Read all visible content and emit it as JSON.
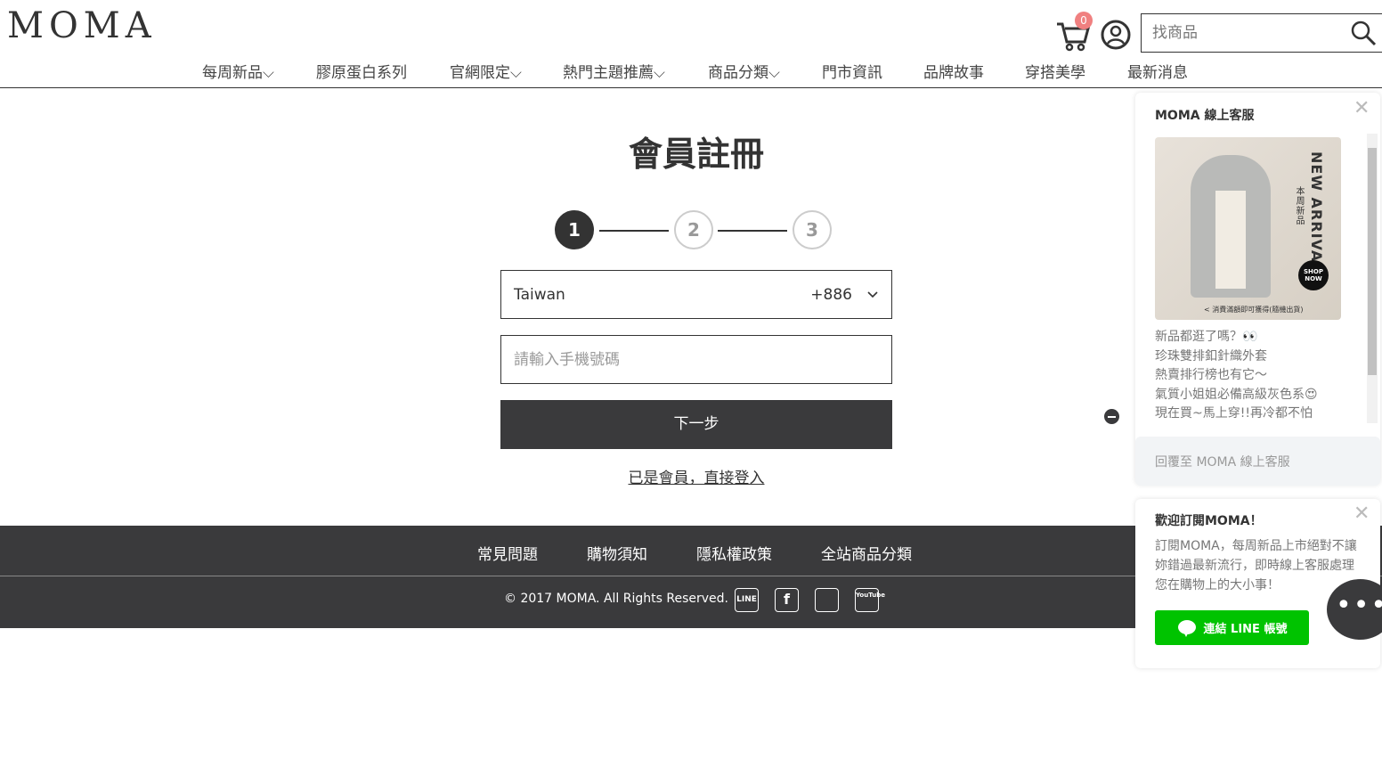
{
  "header": {
    "logo": "MOMA",
    "cart_count": "0",
    "search_placeholder": "找商品"
  },
  "nav": [
    "每周新品⌵",
    "膠原蛋白系列",
    "官網限定⌵",
    "熱門主題推薦⌵",
    "商品分類⌵",
    "門市資訊",
    "品牌故事",
    "穿搭美學",
    "最新消息"
  ],
  "main": {
    "title": "會員註冊",
    "steps": [
      "1",
      "2",
      "3"
    ],
    "current_step": 1,
    "country": "Taiwan",
    "country_code": "+886",
    "phone_placeholder": "請輸入手機號碼",
    "next_label": "下一步",
    "login_link": "已是會員，直接登入"
  },
  "footer": {
    "links": [
      "常見問題",
      "購物須知",
      "隱私權政策",
      "全站商品分類"
    ],
    "copyright": "© 2017 MOMA. All Rights Reserved.",
    "social": [
      "LINE",
      "f",
      "IG",
      "YouTube"
    ]
  },
  "chat": {
    "title": "MOMA 線上客服",
    "promo_title": "NEW ARRIVAL",
    "promo_sub": "本周新品",
    "promo_btn": "SHOP NOW",
    "promo_gift": "< 消費滿額即可獲得(隨機出貨)",
    "message": "新品都逛了嗎？👀\n珍珠雙排釦針織外套\n熱賣排行榜也有它～\n氣質小姐姐必備高級灰色系😍\n現在買~馬上穿!!再冷都不怕",
    "reply_placeholder": "回覆至 MOMA 線上客服"
  },
  "subscribe": {
    "title": "歡迎訂閱MOMA！",
    "desc": "訂閱MOMA，每周新品上市絕對不讓妳錯過最新流行，即時線上客服處理您在購物上的大小事！",
    "button": "連結 LINE 帳號",
    "more": "•••"
  }
}
